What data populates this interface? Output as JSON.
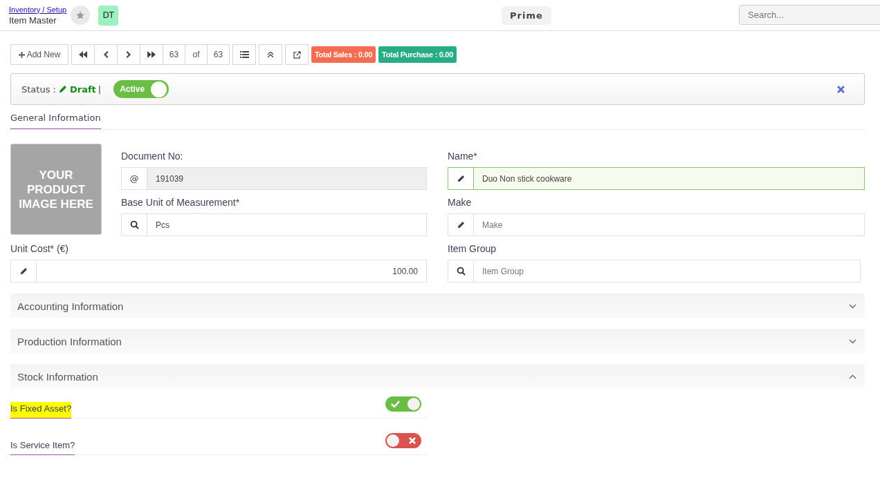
{
  "header": {
    "breadcrumb": "Inventory / Setup",
    "title": "Item Master",
    "avatar": "DT",
    "company": "Prime",
    "search": {
      "placeholder": "Search..."
    }
  },
  "toolbar": {
    "add_label": "Add New",
    "current": "63",
    "of": "of",
    "total": "63",
    "total_sales": "Total Sales : 0.00",
    "total_purchase": "Total Purchase : 0.00"
  },
  "status": {
    "label": "Status :",
    "state": "Draft",
    "separator": "|",
    "active": {
      "label": "Active",
      "on": true
    }
  },
  "tabs": [
    {
      "label": "General Information",
      "selected": true
    }
  ],
  "image_text": "YOUR PRODUCT IMAGE HERE",
  "left_fields": [
    {
      "label": "Document No:",
      "kind": "at",
      "icon_text": "@",
      "value": "191039",
      "readonly": true,
      "valid": false
    },
    {
      "label": "Base Unit of Measurement*",
      "kind": "lookup",
      "value": "Pcs",
      "readonly": false,
      "valid": false
    }
  ],
  "unit_cost": {
    "label": "Unit Cost* (€)",
    "kind": "edit",
    "value": "100.00",
    "readonly": false,
    "valid": false
  },
  "right_fields": [
    {
      "label": "Name*",
      "kind": "edit",
      "value": "Duo Non stick cookware",
      "readonly": false,
      "valid": true
    },
    {
      "label": "Make",
      "kind": "edit",
      "placeholder": "Make",
      "readonly": false,
      "valid": false
    },
    {
      "label": "Item Group",
      "kind": "lookup",
      "placeholder": "Item Group",
      "readonly": false,
      "valid": false
    }
  ],
  "sections": [
    {
      "title": "Accounting Information",
      "expanded": false
    },
    {
      "title": "Production Information",
      "expanded": false
    },
    {
      "title": "Stock Information",
      "expanded": true,
      "switches": [
        {
          "label": "Is Fixed Asset?",
          "on": true,
          "highlighted": true
        },
        {
          "label": "Is Service Item?",
          "on": false,
          "highlighted": false
        }
      ]
    }
  ]
}
